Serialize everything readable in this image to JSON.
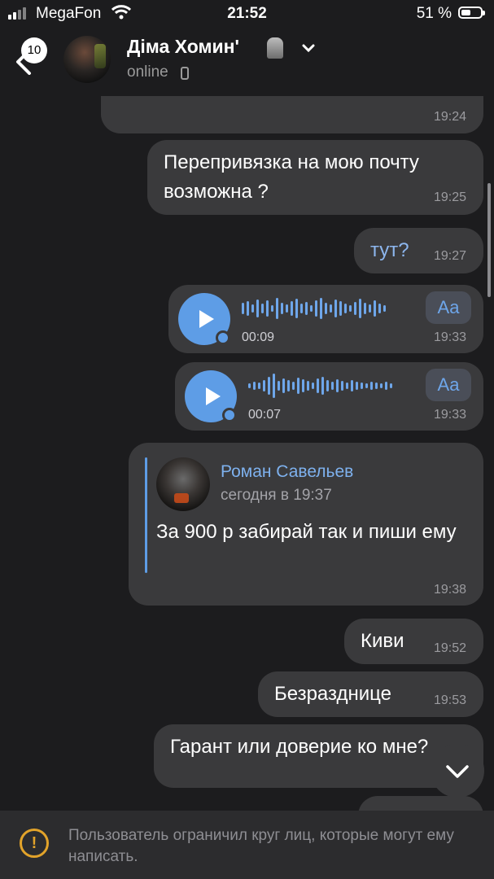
{
  "status_bar": {
    "carrier": "MegaFon",
    "time": "21:52",
    "battery_percent": "51 %",
    "battery_level": 0.51
  },
  "header": {
    "unread_count": "10",
    "contact_name": "Діма Хомин'",
    "presence": "online"
  },
  "messages": [
    {
      "type": "text",
      "time": "19:24",
      "text": ""
    },
    {
      "type": "text",
      "text": "Перепривязка на мою почту возможна ?",
      "time": "19:25"
    },
    {
      "type": "text",
      "text": "тут?",
      "time": "19:27",
      "link": true
    },
    {
      "type": "voice",
      "duration": "00:09",
      "time": "19:33",
      "transcribe_label": "Aa"
    },
    {
      "type": "voice",
      "duration": "00:07",
      "time": "19:33",
      "transcribe_label": "Aa"
    },
    {
      "type": "forward",
      "author": "Роман Савельев",
      "author_time": "сегодня в 19:37",
      "text": "За 900 р забирай так и пиши ему",
      "time": "19:38"
    },
    {
      "type": "text",
      "text": "Киви",
      "time": "19:52"
    },
    {
      "type": "text",
      "text": "Безразднице",
      "time": "19:53"
    },
    {
      "type": "text",
      "text": "Гарант или доверие ко мне?",
      "time": ""
    }
  ],
  "footer": {
    "warning_icon": "exclamation-circle-icon",
    "notice": "Пользователь ограничил круг лиц, которые могут ему написать."
  },
  "colors": {
    "background": "#1c1c1e",
    "bubble": "#3a3a3c",
    "accent": "#5e9de6",
    "warning": "#e2a32a"
  }
}
